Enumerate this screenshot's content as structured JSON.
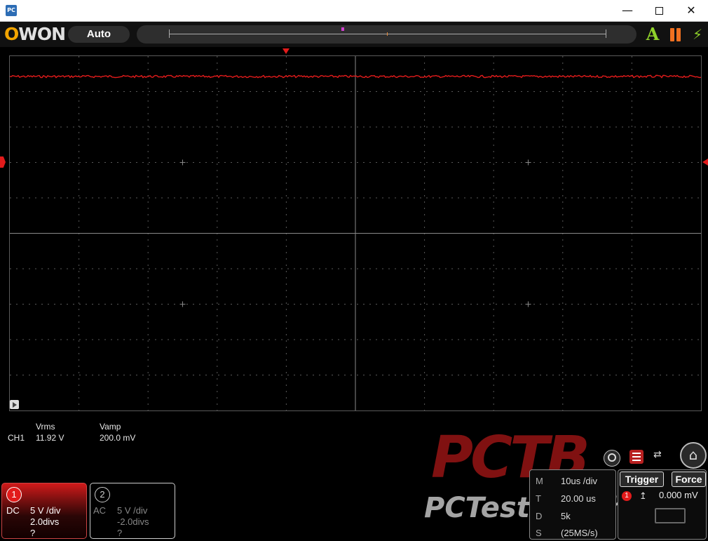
{
  "window": {
    "app_icon": "PC",
    "minimize_icon": "minimize-icon",
    "maximize_icon": "maximize-icon",
    "close_icon": "close-icon"
  },
  "toolbar": {
    "logo": "OWON",
    "mode": "Auto",
    "icons": [
      "auto-set-icon",
      "pause-icon",
      "lightning-icon"
    ]
  },
  "measurements": {
    "row_label": "CH1",
    "headers": [
      "Vrms",
      "Vamp"
    ],
    "values": [
      "11.92 V",
      "200.0 mV"
    ]
  },
  "channels": [
    {
      "number": "1",
      "coupling": "DC",
      "scale": "5 V /div",
      "offset": "2.0divs",
      "extra": "?",
      "active": true
    },
    {
      "number": "2",
      "coupling": "AC",
      "scale": "5 V /div",
      "offset": "-2.0divs",
      "extra": "?",
      "active": false
    }
  ],
  "timebase": {
    "rows": [
      {
        "key": "M",
        "value": "10us /div"
      },
      {
        "key": "T",
        "value": "20.00 us"
      },
      {
        "key": "D",
        "value": "5k"
      },
      {
        "key": "S",
        "value": "(25MS/s)"
      }
    ]
  },
  "trigger": {
    "trigger_label": "Trigger",
    "force_label": "Force",
    "source": "1",
    "level": "0.000 mV"
  },
  "watermark": {
    "logo": "PCTB",
    "text": "PCTestBench"
  },
  "colors": {
    "ch1": "#e21b1b",
    "grid": "#5a5a5a",
    "accent": "#f2a400"
  },
  "trace": {
    "channel": "CH1",
    "level_divs": 2.0,
    "noise_vpp": "200.0 mV"
  }
}
